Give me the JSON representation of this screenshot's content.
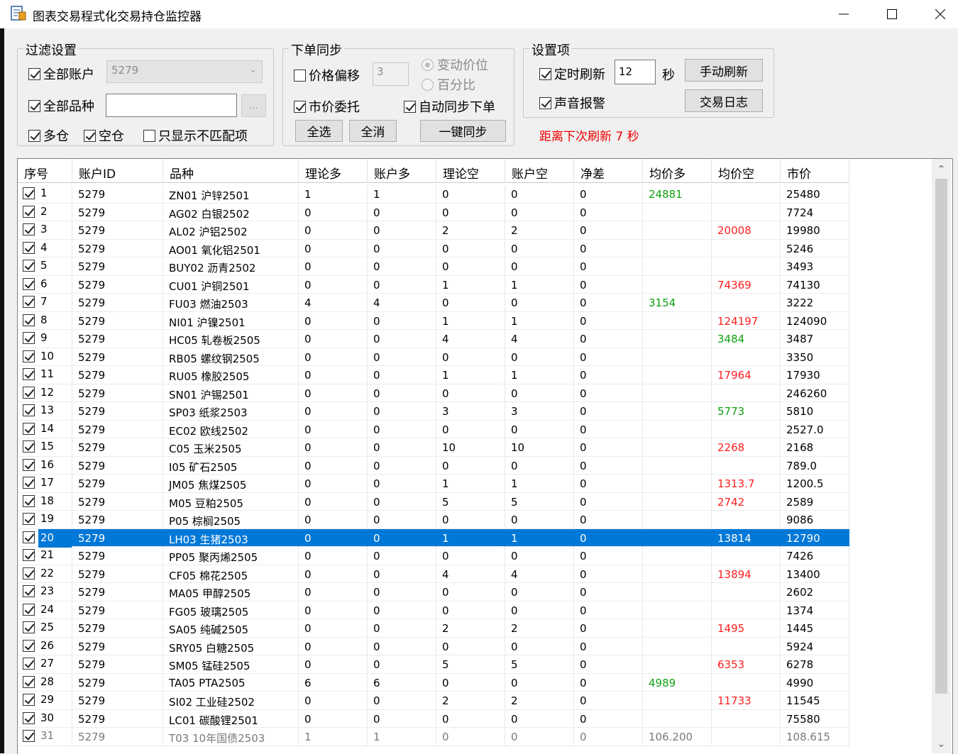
{
  "window": {
    "title": "图表交易程式化交易持仓监控器",
    "icon": "chart-app-icon",
    "controls": {
      "minimize": "minimize-icon",
      "maximize": "maximize-icon",
      "close": "close-icon"
    }
  },
  "filter": {
    "group_title": "过滤设置",
    "all_accounts": {
      "label": "全部账户",
      "checked": true
    },
    "account_select": "5279",
    "all_products": {
      "label": "全部品种",
      "checked": true
    },
    "product_value": "",
    "browse_button": "...",
    "long": {
      "label": "多仓",
      "checked": true
    },
    "short": {
      "label": "空仓",
      "checked": true
    },
    "mismatch_only": {
      "label": "只显示不匹配项",
      "checked": false
    }
  },
  "sync": {
    "group_title": "下单同步",
    "price_offset": {
      "label": "价格偏移",
      "checked": false
    },
    "offset_value": "3",
    "radio_tick": "变动价位",
    "radio_percent": "百分比",
    "market_order": {
      "label": "市价委托",
      "checked": true
    },
    "auto_sync": {
      "label": "自动同步下单",
      "checked": true
    },
    "select_all": "全选",
    "deselect_all": "全消",
    "one_click_sync": "一键同步"
  },
  "settings": {
    "group_title": "设置项",
    "timed_refresh": {
      "label": "定时刷新",
      "checked": true
    },
    "interval_value": "12",
    "interval_unit": "秒",
    "manual_refresh": "手动刷新",
    "sound_alert": {
      "label": "声音报警",
      "checked": true
    },
    "trade_log": "交易日志",
    "countdown": "距离下次刷新 7 秒"
  },
  "colors": {
    "selection": "#0078d7",
    "above_price": "#ff2020",
    "below_price": "#10a010",
    "countdown": "#e00000"
  },
  "table": {
    "columns": [
      "序号",
      "账户ID",
      "品种",
      "理论多",
      "账户多",
      "理论空",
      "账户空",
      "净差",
      "均价多",
      "均价空",
      "市价"
    ],
    "selected_row": "20",
    "rows": [
      {
        "seq": "1",
        "acct": "5279",
        "sym": "ZN01 沪锌2501",
        "tl": "1",
        "al": "1",
        "ts": "0",
        "as": "0",
        "net": "0",
        "avgl": "24881",
        "avgs": "",
        "px": "25480"
      },
      {
        "seq": "2",
        "acct": "5279",
        "sym": "AG02 白银2502",
        "tl": "0",
        "al": "0",
        "ts": "0",
        "as": "0",
        "net": "0",
        "avgl": "",
        "avgs": "",
        "px": "7724"
      },
      {
        "seq": "3",
        "acct": "5279",
        "sym": "AL02 沪铝2502",
        "tl": "0",
        "al": "0",
        "ts": "2",
        "as": "2",
        "net": "0",
        "avgl": "",
        "avgs": "20008",
        "px": "19980"
      },
      {
        "seq": "4",
        "acct": "5279",
        "sym": "AO01 氧化铝2501",
        "tl": "0",
        "al": "0",
        "ts": "0",
        "as": "0",
        "net": "0",
        "avgl": "",
        "avgs": "",
        "px": "5246"
      },
      {
        "seq": "5",
        "acct": "5279",
        "sym": "BUY02 沥青2502",
        "tl": "0",
        "al": "0",
        "ts": "0",
        "as": "0",
        "net": "0",
        "avgl": "",
        "avgs": "",
        "px": "3493"
      },
      {
        "seq": "6",
        "acct": "5279",
        "sym": "CU01 沪铜2501",
        "tl": "0",
        "al": "0",
        "ts": "1",
        "as": "1",
        "net": "0",
        "avgl": "",
        "avgs": "74369",
        "px": "74130"
      },
      {
        "seq": "7",
        "acct": "5279",
        "sym": "FU03 燃油2503",
        "tl": "4",
        "al": "4",
        "ts": "0",
        "as": "0",
        "net": "0",
        "avgl": "3154",
        "avgs": "",
        "px": "3222"
      },
      {
        "seq": "8",
        "acct": "5279",
        "sym": "NI01 沪镍2501",
        "tl": "0",
        "al": "0",
        "ts": "1",
        "as": "1",
        "net": "0",
        "avgl": "",
        "avgs": "124197",
        "px": "124090"
      },
      {
        "seq": "9",
        "acct": "5279",
        "sym": "HC05 轧卷板2505",
        "tl": "0",
        "al": "0",
        "ts": "4",
        "as": "4",
        "net": "0",
        "avgl": "",
        "avgs": "3484",
        "px": "3487"
      },
      {
        "seq": "10",
        "acct": "5279",
        "sym": "RB05 螺纹钢2505",
        "tl": "0",
        "al": "0",
        "ts": "0",
        "as": "0",
        "net": "0",
        "avgl": "",
        "avgs": "",
        "px": "3350"
      },
      {
        "seq": "11",
        "acct": "5279",
        "sym": "RU05 橡胶2505",
        "tl": "0",
        "al": "0",
        "ts": "1",
        "as": "1",
        "net": "0",
        "avgl": "",
        "avgs": "17964",
        "px": "17930"
      },
      {
        "seq": "12",
        "acct": "5279",
        "sym": "SN01 沪锡2501",
        "tl": "0",
        "al": "0",
        "ts": "0",
        "as": "0",
        "net": "0",
        "avgl": "",
        "avgs": "",
        "px": "246260"
      },
      {
        "seq": "13",
        "acct": "5279",
        "sym": "SP03 纸浆2503",
        "tl": "0",
        "al": "0",
        "ts": "3",
        "as": "3",
        "net": "0",
        "avgl": "",
        "avgs": "5773",
        "px": "5810"
      },
      {
        "seq": "14",
        "acct": "5279",
        "sym": "EC02 欧线2502",
        "tl": "0",
        "al": "0",
        "ts": "0",
        "as": "0",
        "net": "0",
        "avgl": "",
        "avgs": "",
        "px": "2527.0"
      },
      {
        "seq": "15",
        "acct": "5279",
        "sym": "C05 玉米2505",
        "tl": "0",
        "al": "0",
        "ts": "10",
        "as": "10",
        "net": "0",
        "avgl": "",
        "avgs": "2268",
        "px": "2168"
      },
      {
        "seq": "16",
        "acct": "5279",
        "sym": "I05 矿石2505",
        "tl": "0",
        "al": "0",
        "ts": "0",
        "as": "0",
        "net": "0",
        "avgl": "",
        "avgs": "",
        "px": "789.0"
      },
      {
        "seq": "17",
        "acct": "5279",
        "sym": "JM05 焦煤2505",
        "tl": "0",
        "al": "0",
        "ts": "1",
        "as": "1",
        "net": "0",
        "avgl": "",
        "avgs": "1313.7",
        "px": "1200.5"
      },
      {
        "seq": "18",
        "acct": "5279",
        "sym": "M05 豆粕2505",
        "tl": "0",
        "al": "0",
        "ts": "5",
        "as": "5",
        "net": "0",
        "avgl": "",
        "avgs": "2742",
        "px": "2589"
      },
      {
        "seq": "19",
        "acct": "5279",
        "sym": "P05 棕榈2505",
        "tl": "0",
        "al": "0",
        "ts": "0",
        "as": "0",
        "net": "0",
        "avgl": "",
        "avgs": "",
        "px": "9086"
      },
      {
        "seq": "20",
        "acct": "5279",
        "sym": "LH03 生猪2503",
        "tl": "0",
        "al": "0",
        "ts": "1",
        "as": "1",
        "net": "0",
        "avgl": "",
        "avgs": "13814",
        "px": "12790"
      },
      {
        "seq": "21",
        "acct": "5279",
        "sym": "PP05 聚丙烯2505",
        "tl": "0",
        "al": "0",
        "ts": "0",
        "as": "0",
        "net": "0",
        "avgl": "",
        "avgs": "",
        "px": "7426"
      },
      {
        "seq": "22",
        "acct": "5279",
        "sym": "CF05 棉花2505",
        "tl": "0",
        "al": "0",
        "ts": "4",
        "as": "4",
        "net": "0",
        "avgl": "",
        "avgs": "13894",
        "px": "13400"
      },
      {
        "seq": "23",
        "acct": "5279",
        "sym": "MA05 甲醇2505",
        "tl": "0",
        "al": "0",
        "ts": "0",
        "as": "0",
        "net": "0",
        "avgl": "",
        "avgs": "",
        "px": "2602"
      },
      {
        "seq": "24",
        "acct": "5279",
        "sym": "FG05 玻璃2505",
        "tl": "0",
        "al": "0",
        "ts": "0",
        "as": "0",
        "net": "0",
        "avgl": "",
        "avgs": "",
        "px": "1374"
      },
      {
        "seq": "25",
        "acct": "5279",
        "sym": "SA05 纯碱2505",
        "tl": "0",
        "al": "0",
        "ts": "2",
        "as": "2",
        "net": "0",
        "avgl": "",
        "avgs": "1495",
        "px": "1445"
      },
      {
        "seq": "26",
        "acct": "5279",
        "sym": "SRY05 白糖2505",
        "tl": "0",
        "al": "0",
        "ts": "0",
        "as": "0",
        "net": "0",
        "avgl": "",
        "avgs": "",
        "px": "5924"
      },
      {
        "seq": "27",
        "acct": "5279",
        "sym": "SM05 锰硅2505",
        "tl": "0",
        "al": "0",
        "ts": "5",
        "as": "5",
        "net": "0",
        "avgl": "",
        "avgs": "6353",
        "px": "6278"
      },
      {
        "seq": "28",
        "acct": "5279",
        "sym": "TA05 PTA2505",
        "tl": "6",
        "al": "6",
        "ts": "0",
        "as": "0",
        "net": "0",
        "avgl": "4989",
        "avgs": "",
        "px": "4990"
      },
      {
        "seq": "29",
        "acct": "5279",
        "sym": "SI02 工业硅2502",
        "tl": "0",
        "al": "0",
        "ts": "2",
        "as": "2",
        "net": "0",
        "avgl": "",
        "avgs": "11733",
        "px": "11545"
      },
      {
        "seq": "30",
        "acct": "5279",
        "sym": "LC01 碳酸锂2501",
        "tl": "0",
        "al": "0",
        "ts": "0",
        "as": "0",
        "net": "0",
        "avgl": "",
        "avgs": "",
        "px": "75580"
      },
      {
        "seq": "31",
        "acct": "5279",
        "sym": "T03 10年国债2503",
        "tl": "1",
        "al": "1",
        "ts": "0",
        "as": "0",
        "net": "0",
        "avgl": "106.200",
        "avgs": "",
        "px": "108.615"
      }
    ]
  }
}
